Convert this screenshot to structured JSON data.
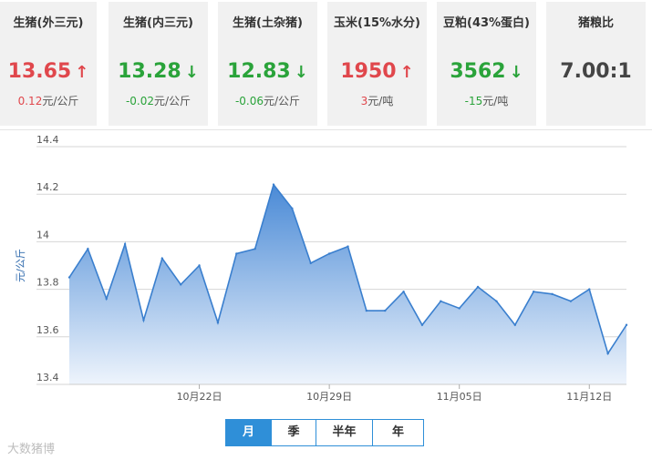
{
  "cards": [
    {
      "title": "生猪(外三元)",
      "price": "13.65",
      "change": "0.12",
      "unit": "元/公斤",
      "direction": "up",
      "arrow": "↑"
    },
    {
      "title": "生猪(内三元)",
      "price": "13.28",
      "change": "-0.02",
      "unit": "元/公斤",
      "direction": "down",
      "arrow": "↓"
    },
    {
      "title": "生猪(土杂猪)",
      "price": "12.83",
      "change": "-0.06",
      "unit": "元/公斤",
      "direction": "down",
      "arrow": "↓"
    },
    {
      "title": "玉米(15%水分)",
      "price": "1950",
      "change": "3",
      "unit": "元/吨",
      "direction": "up",
      "arrow": "↑"
    },
    {
      "title": "豆粕(43%蛋白)",
      "price": "3562",
      "change": "-15",
      "unit": "元/吨",
      "direction": "down",
      "arrow": "↓"
    },
    {
      "title": "猪粮比",
      "price": "7.00:1",
      "change": "",
      "unit": "",
      "direction": "flat",
      "arrow": ""
    }
  ],
  "range_buttons": [
    {
      "label": "月",
      "active": true
    },
    {
      "label": "季",
      "active": false
    },
    {
      "label": "半年",
      "active": false
    },
    {
      "label": "年",
      "active": false
    }
  ],
  "watermark": "大数猪博",
  "colors": {
    "up": "#e0474c",
    "down": "#2aa33a",
    "line": "#3a7fce",
    "area_top": "#4a8ad6",
    "area_bottom": "#eef4fc",
    "button": "#2f8fd8"
  },
  "chart_data": {
    "type": "area",
    "ylabel": "元/公斤",
    "ylim": [
      13.4,
      14.4
    ],
    "yticks": [
      "14.4",
      "14.2",
      "14",
      "13.8",
      "13.6",
      "13.4"
    ],
    "xticks": [
      "10月22日",
      "10月29日",
      "11月05日",
      "11月12日"
    ],
    "grid": true,
    "values": [
      13.85,
      13.97,
      13.76,
      13.99,
      13.67,
      13.93,
      13.82,
      13.9,
      13.66,
      13.95,
      13.97,
      14.24,
      14.14,
      13.91,
      13.95,
      13.98,
      13.71,
      13.71,
      13.79,
      13.65,
      13.75,
      13.72,
      13.81,
      13.75,
      13.65,
      13.79,
      13.78,
      13.75,
      13.8,
      13.53,
      13.65
    ]
  }
}
